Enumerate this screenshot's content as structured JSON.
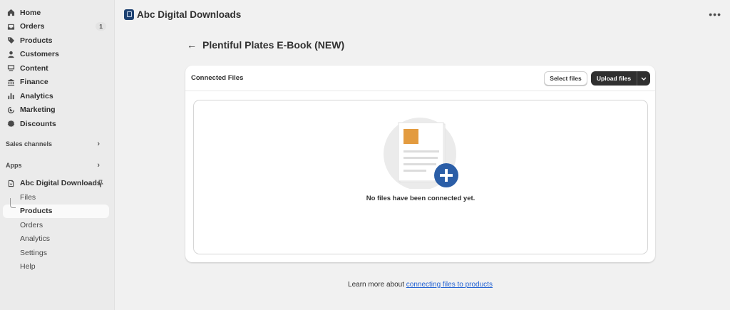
{
  "sidebar": {
    "main_items": [
      {
        "label": "Home",
        "icon": "home-icon"
      },
      {
        "label": "Orders",
        "icon": "inbox-icon",
        "badge": "1"
      },
      {
        "label": "Products",
        "icon": "tag-icon"
      },
      {
        "label": "Customers",
        "icon": "person-icon"
      },
      {
        "label": "Content",
        "icon": "content-icon"
      },
      {
        "label": "Finance",
        "icon": "bank-icon"
      },
      {
        "label": "Analytics",
        "icon": "bar-chart-icon"
      },
      {
        "label": "Marketing",
        "icon": "target-icon"
      },
      {
        "label": "Discounts",
        "icon": "discount-icon"
      }
    ],
    "sales_channels_label": "Sales channels",
    "apps_label": "Apps",
    "app_name": "Abc Digital Downloads",
    "app_sub_items": [
      "Files",
      "Products",
      "Orders",
      "Analytics",
      "Settings",
      "Help"
    ],
    "active_sub_item": "Products"
  },
  "topbar": {
    "app_title": "Abc Digital Downloads"
  },
  "page": {
    "title": "Plentiful Plates E-Book (NEW)"
  },
  "card": {
    "title": "Connected Files",
    "select_button": "Select files",
    "upload_button": "Upload files",
    "empty_message": "No files have been connected yet."
  },
  "footer": {
    "prefix": "Learn more about ",
    "link_text": "connecting files to products"
  },
  "colors": {
    "accent_dark": "#303030",
    "link": "#2463d3",
    "illustration_orange": "#e39b3f",
    "plus_blue": "#2b5ea7"
  }
}
